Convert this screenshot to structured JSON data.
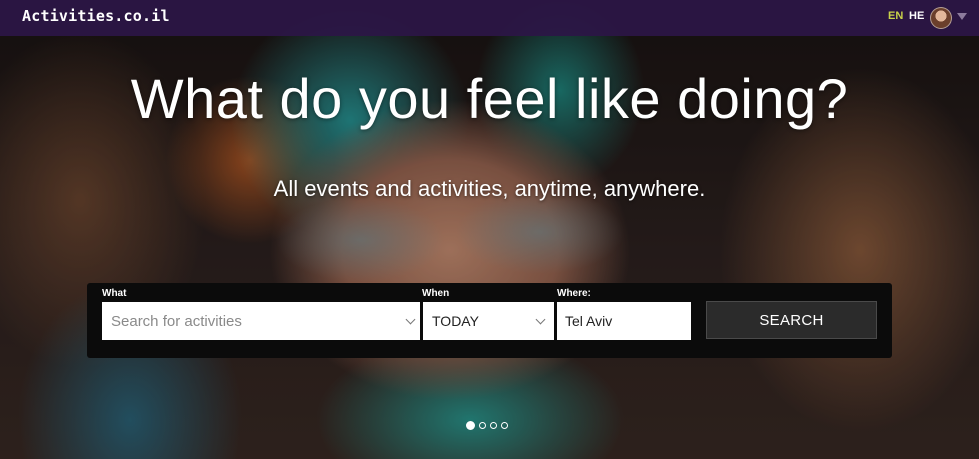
{
  "header": {
    "logo": "Activities.co.il",
    "languages": [
      "EN",
      "HE"
    ],
    "active_language": "EN",
    "accent_color": "#c9d24a",
    "bar_color": "#2c1646"
  },
  "hero": {
    "title": "What do you feel like doing?",
    "subtitle": "All events and activities, anytime, anywhere."
  },
  "search": {
    "what_label": "What",
    "what_placeholder": "Search for activities",
    "when_label": "When",
    "when_value": "TODAY",
    "where_label": "Where:",
    "where_value": "Tel Aviv",
    "button_label": "SEARCH"
  },
  "carousel": {
    "slide_count": 4,
    "active_index": 0
  },
  "icons": [
    "avatar",
    "caret-down-icon",
    "chevron-down-icon"
  ]
}
